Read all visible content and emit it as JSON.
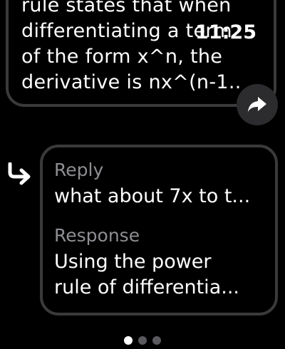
{
  "status_bar": {
    "time": "11:25"
  },
  "previous_message": {
    "lines": [
      "rule states that when",
      "differentiating a term",
      "of the form x^n, the",
      "derivative is nx^(n-1.."
    ]
  },
  "reply_card": {
    "reply_label": "Reply",
    "reply_text": "what about 7x to t...",
    "response_label": "Response",
    "response_lines": [
      "Using the power",
      "rule of differentia..."
    ]
  },
  "page_indicator": {
    "count": 3,
    "active_index": 0
  },
  "icons": {
    "share": "share-arrow-icon",
    "reply": "reply-arrow-icon"
  },
  "colors": {
    "background": "#000000",
    "border": "#3a3a3c",
    "secondary_text": "#8e8e93",
    "button": "#2c2c2e"
  }
}
